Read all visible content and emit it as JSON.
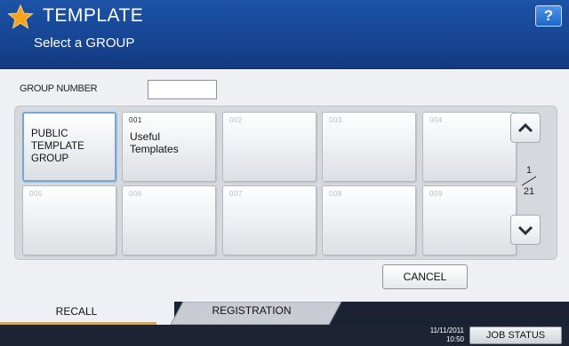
{
  "header": {
    "title": "TEMPLATE",
    "subtitle": "Select a GROUP",
    "help_label": "?",
    "star_icon": "star-icon",
    "color": "#174592"
  },
  "group_number": {
    "label": "GROUP NUMBER",
    "value": ""
  },
  "groups": [
    {
      "number": "",
      "name": "PUBLIC\nTEMPLATE\nGROUP",
      "selected": true
    },
    {
      "number": "001",
      "name": "Useful\nTemplates"
    },
    {
      "number": "002",
      "name": ""
    },
    {
      "number": "003",
      "name": ""
    },
    {
      "number": "004",
      "name": ""
    },
    {
      "number": "005",
      "name": ""
    },
    {
      "number": "006",
      "name": ""
    },
    {
      "number": "007",
      "name": ""
    },
    {
      "number": "008",
      "name": ""
    },
    {
      "number": "009",
      "name": ""
    }
  ],
  "pagination": {
    "current": "1",
    "total": "21",
    "up_icon": "chevron-up-icon",
    "down_icon": "chevron-down-icon"
  },
  "cancel_label": "CANCEL",
  "tabs": {
    "recall": "RECALL",
    "registration": "REGISTRATION",
    "accent": "#f2a51d"
  },
  "status": {
    "date": "11/11/2011",
    "time": "10:50",
    "job_status": "JOB STATUS"
  }
}
